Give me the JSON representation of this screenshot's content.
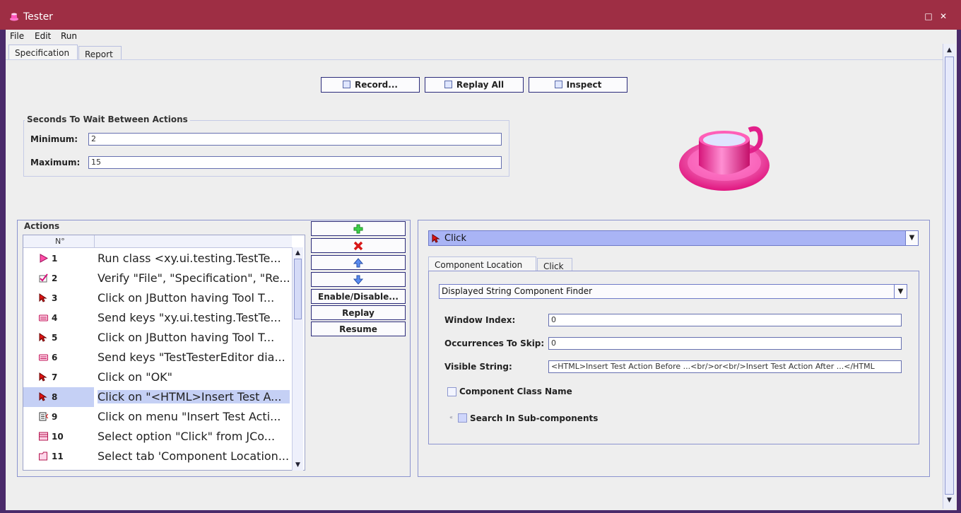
{
  "window": {
    "title": "Tester",
    "restore_glyph": "□",
    "close_glyph": "✕"
  },
  "menu": [
    "File",
    "Edit",
    "Run"
  ],
  "tabs": {
    "spec": "Specification",
    "report": "Report"
  },
  "toolbar": {
    "record": "Record...",
    "replay_all": "Replay All",
    "inspect": "Inspect"
  },
  "wait": {
    "title": "Seconds To Wait Between Actions",
    "min_label": "Minimum:",
    "min_value": "2",
    "max_label": "Maximum:",
    "max_value": "15"
  },
  "actions": {
    "title": "Actions",
    "col_num": "N°",
    "rows": [
      {
        "n": "1",
        "desc": "Run class  <xy.ui.testing.TestTe...",
        "icon": "play-icon"
      },
      {
        "n": "2",
        "desc": "Verify \"File\", \"Specification\", \"Re...",
        "icon": "verify-icon"
      },
      {
        "n": "3",
        "desc": "Click on JButton having  Tool T...",
        "icon": "cursor-icon"
      },
      {
        "n": "4",
        "desc": "Send keys \"xy.ui.testing.TestTe...",
        "icon": "keyboard-icon"
      },
      {
        "n": "5",
        "desc": "Click on JButton having  Tool T...",
        "icon": "cursor-icon"
      },
      {
        "n": "6",
        "desc": "Send keys \"TestTesterEditor dia...",
        "icon": "keyboard-icon"
      },
      {
        "n": "7",
        "desc": "Click on \"OK\"",
        "icon": "cursor-icon"
      },
      {
        "n": "8",
        "desc": "Click on \"<HTML>Insert Test A...",
        "icon": "cursor-icon",
        "selected": true
      },
      {
        "n": "9",
        "desc": "Click on menu \"Insert Test Acti...",
        "icon": "menu-icon"
      },
      {
        "n": "10",
        "desc": "Select option  \"Click\" from JCo...",
        "icon": "combo-icon"
      },
      {
        "n": "11",
        "desc": "Select tab 'Component Location...",
        "icon": "tab-icon"
      }
    ],
    "buttons": {
      "enable": "Enable/Disable...",
      "replay": "Replay",
      "resume": "Resume"
    }
  },
  "detail": {
    "action_type": "Click",
    "tabs": {
      "location": "Component Location",
      "click": "Click"
    },
    "finder": "Displayed String Component Finder",
    "window_index_label": "Window Index:",
    "window_index": "0",
    "occ_label": "Occurrences To Skip:",
    "occ": "0",
    "visible_label": "Visible String:",
    "visible": "<HTML>Insert Test Action Before ...<br/>or<br/>Insert Test Action After ...</HTML",
    "class_name_label": "Component Class Name",
    "sub_label": "Search In Sub-components"
  },
  "colors": {
    "titlebar": "#9e2e44",
    "selection": "#c5d0f5",
    "combo": "#a9b4f5"
  }
}
